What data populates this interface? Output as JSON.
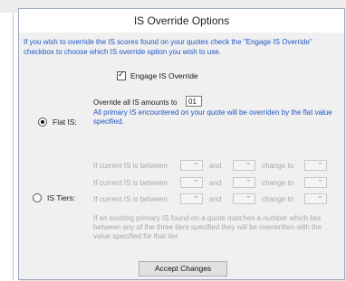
{
  "dialog": {
    "title": "IS Override Options",
    "intro": "If you wish to override the IS scores found on your quotes check the \"Engage IS Override\" checkbox to choose which IS override option you wish to use.",
    "engage_label": "Engage IS Override",
    "engage_checked": true
  },
  "flat": {
    "radio_label": "Flat IS:",
    "selected": true,
    "override_label": "Override all IS amounts to",
    "override_value": "01",
    "description": "All primary IS encountered on your quote will be overriden by the flat value specified."
  },
  "tiers": {
    "radio_label": "IS Tiers:",
    "selected": false,
    "rows": [
      {
        "label": "If current IS is between",
        "and": "and",
        "change": "change to"
      },
      {
        "label": "If current IS is between",
        "and": "and",
        "change": "change to"
      },
      {
        "label": "If current IS is between",
        "and": "and",
        "change": "change to"
      }
    ],
    "note": "If an existing primary IS found on a quote matches a number which lies between any of the three tiers specified they will be overwritten with the value specified for that tier."
  },
  "actions": {
    "accept_label": "Accept Changes"
  },
  "colors": {
    "info_text": "#1f56c4",
    "disabled_text": "#a9a9a9"
  }
}
